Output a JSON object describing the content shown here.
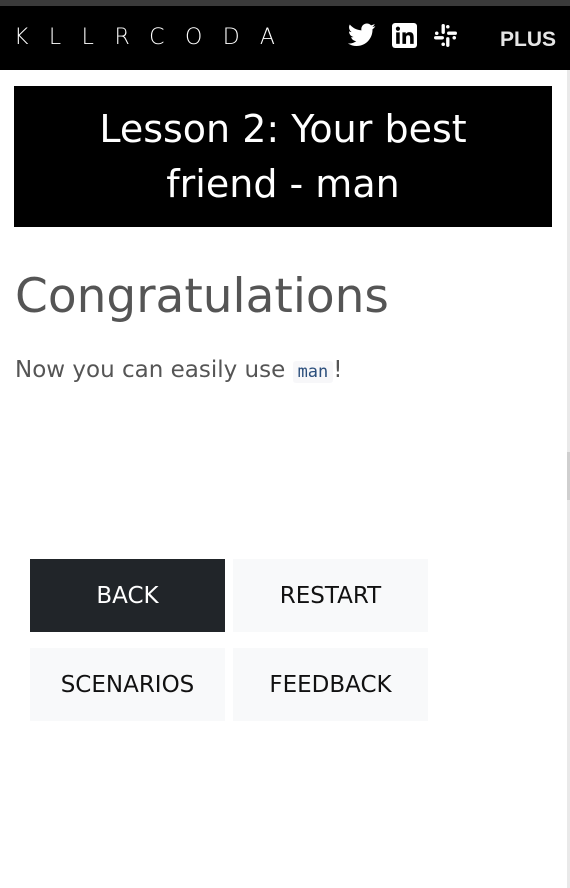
{
  "navbar": {
    "logo": "KLLRCODA",
    "social": [
      "twitter-icon",
      "linkedin-icon",
      "slack-icon"
    ],
    "plus_label": "PLUS"
  },
  "lesson": {
    "title": "Lesson 2: Your best friend - man"
  },
  "finish": {
    "heading": "Congratulations",
    "message_prefix": "Now you can easily use ",
    "command": "man",
    "message_suffix": "!"
  },
  "buttons": {
    "back": "BACK",
    "restart": "RESTART",
    "scenarios": "SCENARIOS",
    "feedback": "FEEDBACK"
  },
  "colors": {
    "navbar_bg": "#000000",
    "heading_text": "#555555",
    "dark_button": "#212529",
    "light_button": "#f8f9fa",
    "code_text": "#2c4f7c"
  }
}
